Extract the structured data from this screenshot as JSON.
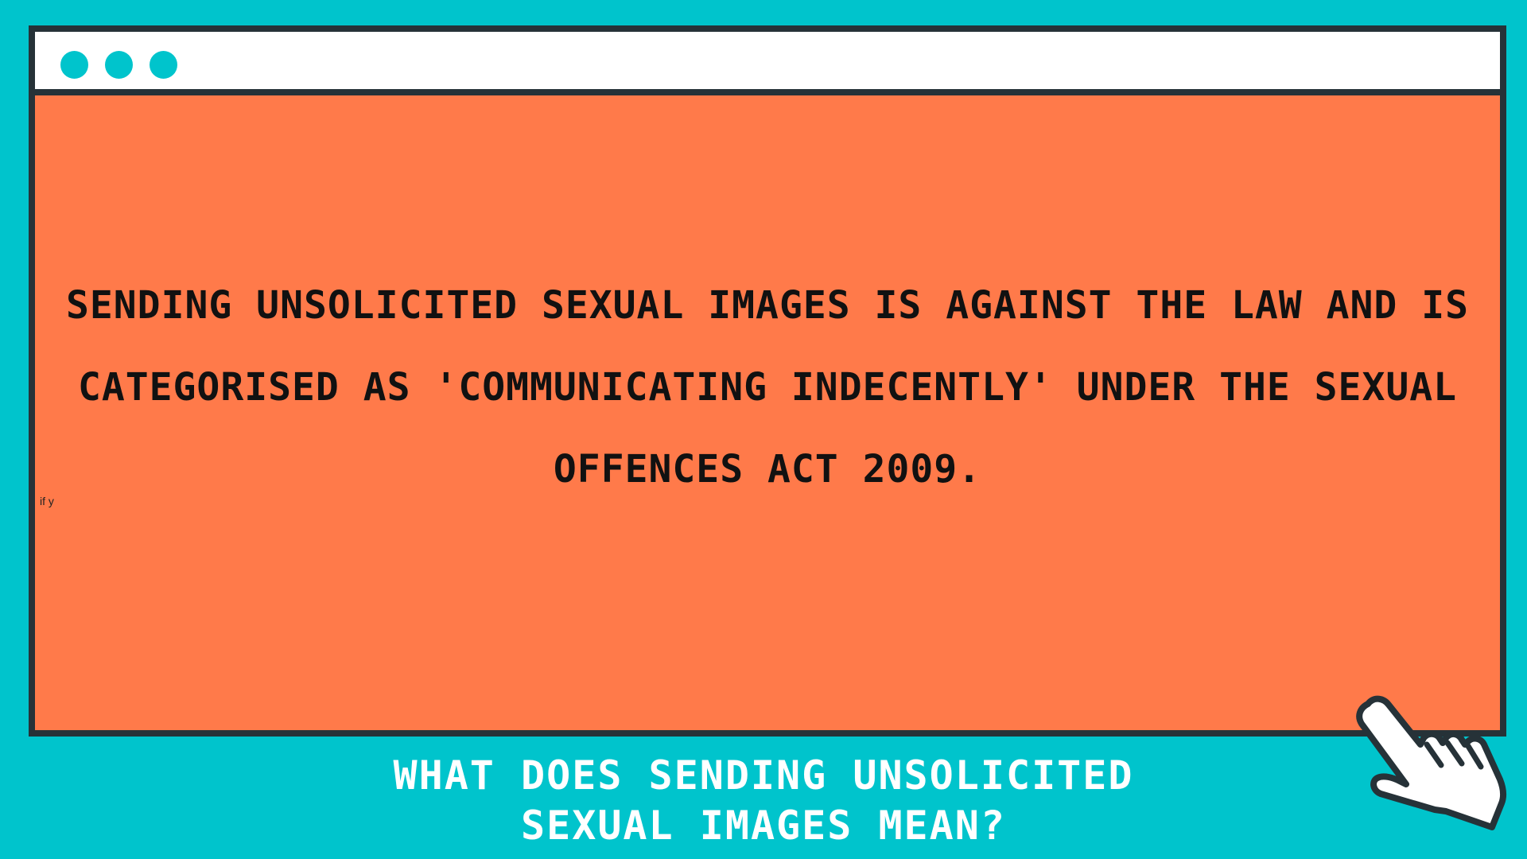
{
  "window": {
    "titlebar_dots": [
      "dot-1",
      "dot-2",
      "dot-3"
    ],
    "accent_color": "#00c4cc",
    "content_background": "#ff7a4a",
    "frame_color": "#263238"
  },
  "content": {
    "message": "SENDING UNSOLICITED SEXUAL IMAGES IS AGAINST THE LAW AND IS CATEGORISED AS 'COMMUNICATING INDECENTLY' UNDER THE SEXUAL OFFENCES ACT 2009.",
    "stray_text": "if y"
  },
  "caption": {
    "line1": "WHAT DOES SENDING UNSOLICITED",
    "line2": "SEXUAL IMAGES MEAN?"
  },
  "icons": {
    "cursor": "hand-pointer-icon"
  }
}
